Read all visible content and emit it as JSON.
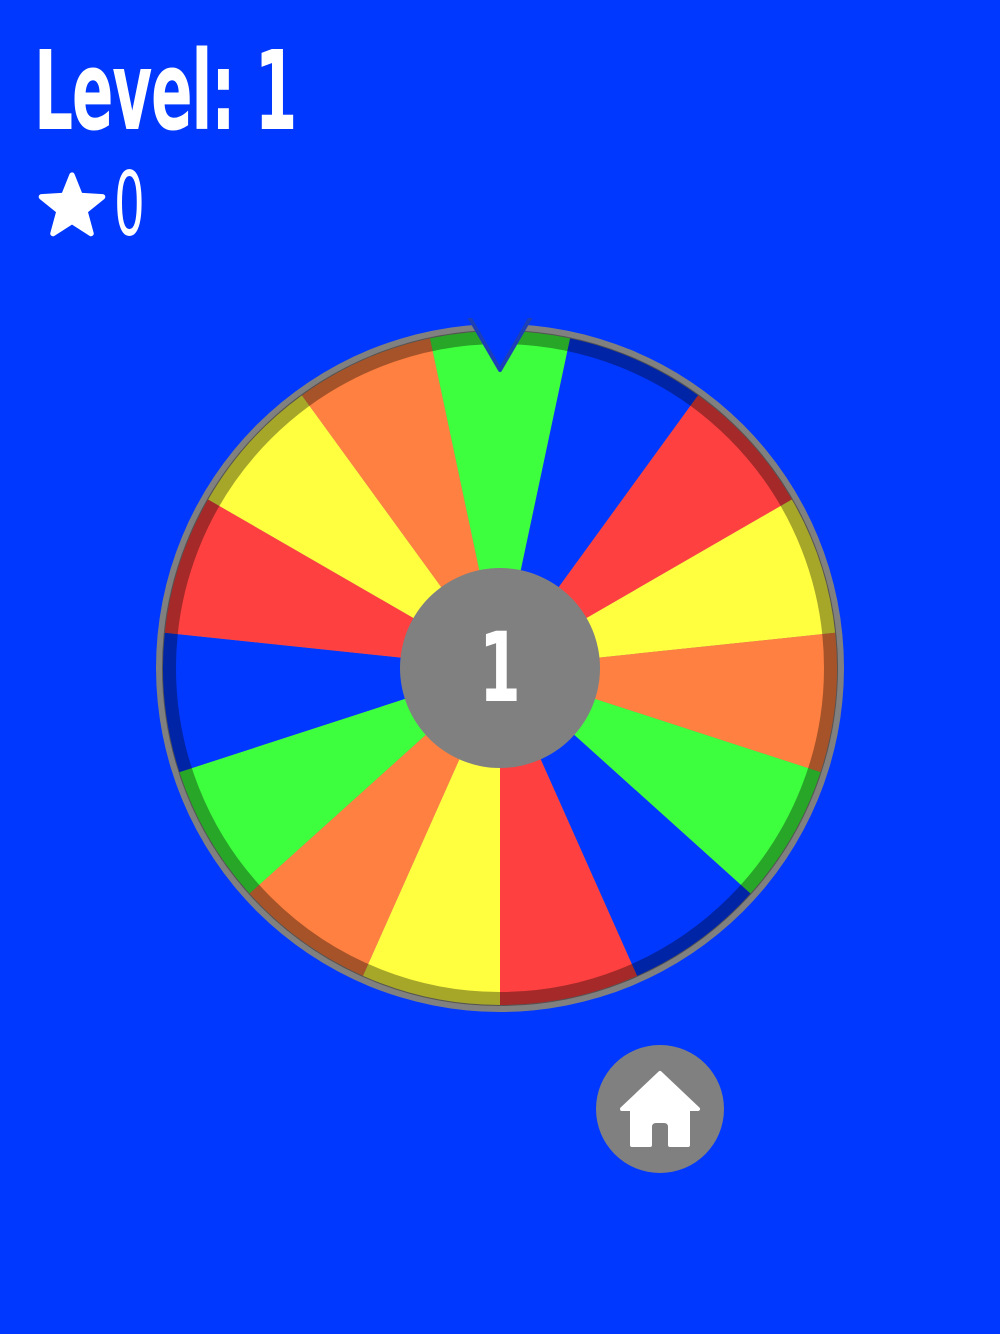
{
  "hud": {
    "level_label": "Level: 1",
    "star_icon": "star-icon",
    "star_count": "0"
  },
  "wheel": {
    "center_number": "1",
    "pointer_icon": "triangle-pointer-icon",
    "segment_colors": [
      "#3dff3d",
      "#0038ff",
      "#ff4040",
      "#ffff40",
      "#ff8040",
      "#3dff3d",
      "#0038ff",
      "#ff4040",
      "#ffff40",
      "#ff8040",
      "#3dff3d",
      "#0038ff",
      "#ff4040",
      "#ffff40",
      "#ff8040"
    ],
    "rim_color": "#808080",
    "hub_color": "#808080"
  },
  "home_button": {
    "icon": "home-icon"
  },
  "colors": {
    "background": "#0038ff",
    "text": "#ffffff"
  }
}
